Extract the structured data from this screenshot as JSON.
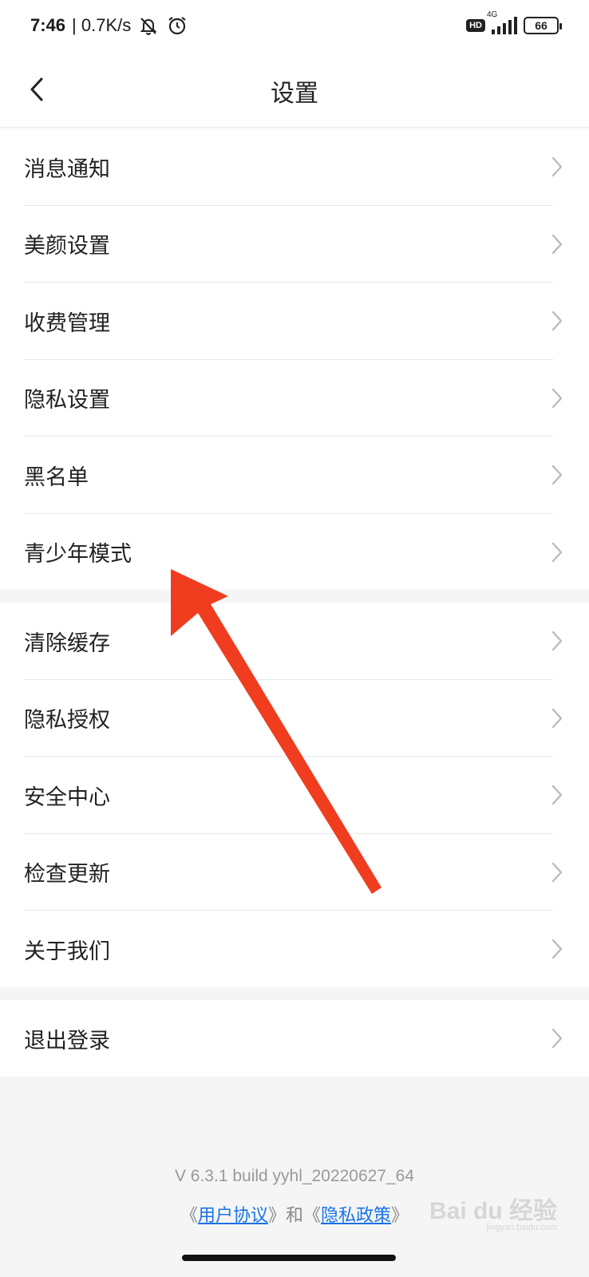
{
  "status_bar": {
    "time": "7:46",
    "network_speed": "| 0.7K/s",
    "hd_badge": "HD",
    "network_type": "4G",
    "battery_level": "66",
    "icons": [
      "mute-icon",
      "alarm-icon",
      "signal-icon",
      "battery-icon"
    ]
  },
  "header": {
    "title": "设置",
    "back_icon": "chevron-left-icon"
  },
  "groups": [
    {
      "items": [
        {
          "label": "消息通知"
        },
        {
          "label": "美颜设置"
        },
        {
          "label": "收费管理"
        },
        {
          "label": "隐私设置"
        },
        {
          "label": "黑名单"
        },
        {
          "label": "青少年模式"
        }
      ]
    },
    {
      "items": [
        {
          "label": "清除缓存"
        },
        {
          "label": "隐私授权"
        },
        {
          "label": "安全中心"
        },
        {
          "label": "检查更新"
        },
        {
          "label": "关于我们"
        }
      ]
    },
    {
      "items": [
        {
          "label": "退出登录"
        }
      ]
    }
  ],
  "footer": {
    "version": "V 6.3.1 build yyhl_20220627_64",
    "open_bracket_1": "《",
    "user_agreement": "用户协议",
    "close_bracket_1": "》",
    "and_text": "和",
    "open_bracket_2": "《",
    "privacy_policy": "隐私政策",
    "close_bracket_2": "》"
  },
  "watermark": {
    "text": "Bai du 经验",
    "url": "jingyan.baidu.com"
  },
  "annotation": {
    "arrow_color": "#f03c1f",
    "points_to": "青少年模式"
  }
}
